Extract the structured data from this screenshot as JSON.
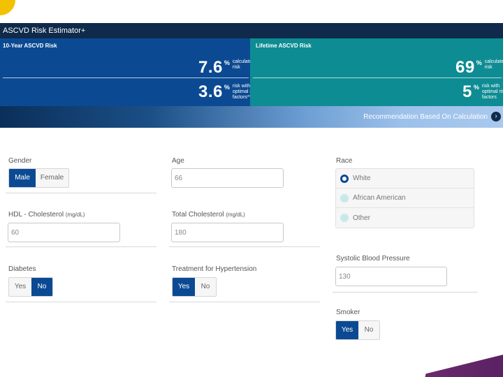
{
  "app": {
    "title": "ASCVD Risk Estimator+"
  },
  "results": {
    "ten_year": {
      "heading": "10-Year ASCVD Risk",
      "calculated": {
        "value": "7.6",
        "unit": "%",
        "label": "calculated risk"
      },
      "optimal": {
        "value": "3.6",
        "unit": "%",
        "label": "risk with optimal risk factors**"
      }
    },
    "lifetime": {
      "heading": "Lifetime ASCVD Risk",
      "calculated": {
        "value": "69",
        "unit": "%",
        "label": "calculated risk"
      },
      "optimal": {
        "value": "5",
        "unit": "%",
        "label": "risk with optimal risk factors"
      }
    },
    "recommendation_link": "Recommendation Based On Calculation"
  },
  "form": {
    "gender": {
      "label": "Gender",
      "options": [
        "Male",
        "Female"
      ],
      "selected": "Male"
    },
    "age": {
      "label": "Age",
      "value": "66"
    },
    "race": {
      "label": "Race",
      "options": [
        "White",
        "African American",
        "Other"
      ],
      "selected": "White"
    },
    "hdl": {
      "label": "HDL - Cholesterol",
      "unit": "(mg/dL)",
      "value": "60"
    },
    "total_chol": {
      "label": "Total Cholesterol",
      "unit": "(mg/dL)",
      "value": "180"
    },
    "systolic": {
      "label": "Systolic Blood Pressure",
      "value": "130"
    },
    "diabetes": {
      "label": "Diabetes",
      "options": [
        "Yes",
        "No"
      ],
      "selected": "No"
    },
    "hypertension": {
      "label": "Treatment for Hypertension",
      "options": [
        "Yes",
        "No"
      ],
      "selected": "Yes"
    },
    "smoker": {
      "label": "Smoker",
      "options": [
        "Yes",
        "No"
      ],
      "selected": "Yes"
    }
  },
  "colors": {
    "primary_blue": "#0b4a93",
    "teal": "#0e8c93",
    "header_navy": "#0f2a4a",
    "slide_yellow": "#f2c200",
    "slide_purple": "#6b2a6e"
  }
}
